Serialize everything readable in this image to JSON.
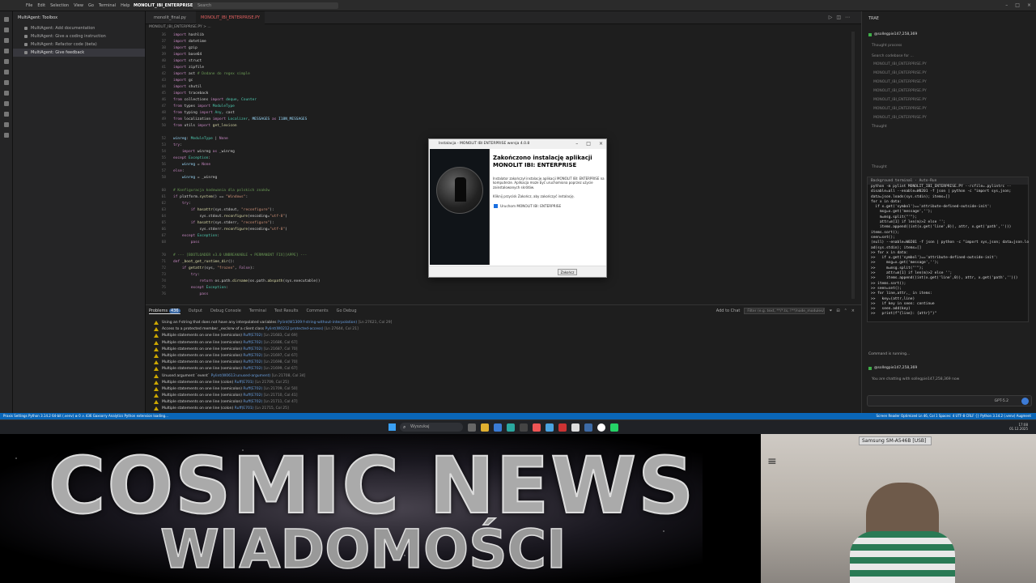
{
  "titlebar": {
    "menu": [
      "File",
      "Edit",
      "Selection",
      "View",
      "Go",
      "Terminal",
      "Help"
    ],
    "project": "MONOLIT_IBI_ENTERPRISE",
    "search": "Search"
  },
  "sidebar": {
    "header": "MultiAgent: Toolbox",
    "items": [
      "MultiAgent: Add documentation",
      "MultiAgent: Give a coding instruction",
      "MultiAgent: Refactor code (beta)",
      "MultiAgent: Give feedback"
    ]
  },
  "editor": {
    "tabs": [
      "monolit_final.py",
      "MONOLIT_IBI_ENTERPRISE.PY"
    ],
    "breadcrumb": "MONOLIT_IBI_ENTERPRISE.PY > ..."
  },
  "panel": {
    "tabs": [
      "Problems",
      "Output",
      "Debug Console",
      "Terminal",
      "Test Results",
      "Comments",
      "Go Debug"
    ],
    "problems_count": "436",
    "add_to_chat": "Add to Chat",
    "filter_placeholder": "Filter (e.g. text, **/*.ts, !**/node_modules/**)",
    "rows": [
      {
        "msg": "Using an f-string that does not have any interpolated variables",
        "src": "Pylint(W1309:f-string-without-interpolation)",
        "loc": "[Ln 27621, Col 29]"
      },
      {
        "msg": "Access to a protected member _exclsrw of a client class",
        "src": "Pylint(W0212:protected-access)",
        "loc": "[Ln 27644, Col 21]"
      },
      {
        "msg": "Multiple statements on one line (semicolon)",
        "src": "Ruff(E702)",
        "loc": "[Ln 21683, Col 69]"
      },
      {
        "msg": "Multiple statements on one line (semicolon)",
        "src": "Ruff(E702)",
        "loc": "[Ln 21686, Col 67]"
      },
      {
        "msg": "Multiple statements on one line (semicolon)",
        "src": "Ruff(E702)",
        "loc": "[Ln 21687, Col 70]"
      },
      {
        "msg": "Multiple statements on one line (semicolon)",
        "src": "Ruff(E702)",
        "loc": "[Ln 21697, Col 67]"
      },
      {
        "msg": "Multiple statements on one line (semicolon)",
        "src": "Ruff(E702)",
        "loc": "[Ln 21698, Col 70]"
      },
      {
        "msg": "Multiple statements on one line (semicolon)",
        "src": "Ruff(E702)",
        "loc": "[Ln 21699, Col 67]"
      },
      {
        "msg": "Unused argument `event`",
        "src": "Pylint(W0613:unused-argument)",
        "loc": "[Ln 21708, Col 34]"
      },
      {
        "msg": "Multiple statements on one line (colon)",
        "src": "Ruff(E701)",
        "loc": "[Ln 21709, Col 25]"
      },
      {
        "msg": "Multiple statements on one line (semicolon)",
        "src": "Ruff(E702)",
        "loc": "[Ln 21709, Col 50]"
      },
      {
        "msg": "Multiple statements on one line (semicolon)",
        "src": "Ruff(E702)",
        "loc": "[Ln 21710, Col 41]"
      },
      {
        "msg": "Multiple statements on one line (semicolon)",
        "src": "Ruff(E702)",
        "loc": "[Ln 21711, Col 47]"
      },
      {
        "msg": "Multiple statements on one line (colon)",
        "src": "Ruff(E701)",
        "loc": "[Ln 21715, Col 25]"
      }
    ]
  },
  "chat": {
    "title": "TRAE",
    "user": "@sollegpie147,258,369",
    "thought": "Thought process",
    "thought2": "Search codebase for ...",
    "files": [
      "MONOLIT_IBI_ENTERPRISE.PY",
      "MONOLIT_IBI_ENTERPRISE.PY",
      "MONOLIT_IBI_ENTERPRISE.PY",
      "MONOLIT_IBI_ENTERPRISE.PY",
      "MONOLIT_IBI_ENTERPRISE.PY",
      "MONOLIT_IBI_ENTERPRISE.PY",
      "MONOLIT_IBI_ENTERPRISE.PY"
    ],
    "thought3": "Thought",
    "thought4": "Thought",
    "terminal_header": "Background terminal · Auto-Run",
    "terminal_lines": [
      "python -m pylint MONOLIT_IBI_ENTERPRISE.PY --rcfile=.pylintrc --",
      "disable=all --enable=W0201 -f json | python -c \"import sys,json;",
      "data=json.loads(sys.stdin); items=[]",
      "for x in data:",
      "  if x.get('symbol')=='attribute-defined-outside-init':",
      "    msg=x.get('message','');",
      "    m=msg.split(\"'\");",
      "    attr=m[1] if len(m)>2 else '';",
      "    items.append((int(x.get('line',0)), attr, x.get('path','')))",
      "items.sort();",
      "seen=set();",
      "",
      "(null) --enable=W0201 -f json | python -c \"import sys,json; data=json.lo",
      "ad(sys.stdin); items=[]",
      ">> for x in data:",
      ">>   if x.get('symbol')=='attribute-defined-outside-init':",
      ">>     msg=x.get('message','');",
      ">>     m=msg.split(\"'\");",
      ">>     attr=m[1] if len(m)>2 else '';",
      ">>     items.append((int(x.get('line',0)), attr, x.get('path','')))",
      ">> items.sort();",
      ">> seen=set();",
      ">> for line,attr,_ in items:",
      ">>   key=(attr,line)",
      ">>   if key in seen: continue",
      ">>   seen.add(key)",
      ">>   print(f\"{line}: {attr}\")\""
    ],
    "running": "Command is running...",
    "user2": "@sollegpie147,258,369",
    "chatting": "You are chatting with sollegpie147,258,369 now",
    "model": "GPT-5.2"
  },
  "dialog": {
    "title": "Instalacja - MONOLIT IBI ENTERPRISE wersja 4.0.8",
    "heading": "Zakończono instalację aplikacji MONOLIT IBI: ENTERPRISE",
    "body": "Instalator zakończył instalację aplikacji MONOLIT IBI: ENTERPRISE na komputerze. Aplikacja może być uruchomiona poprzez użycie zainstalowanych skrótów.",
    "body2": "Kliknij przycisk Zakończ, aby zakończyć instalację.",
    "checkbox": "Uruchom MONOLIT IBI: ENTERPRISE",
    "finish": "Zakończ"
  },
  "statusbar": {
    "left": "Praxis Settings   Python 3.14.2 64-bit (.venv)   ⊗ 0 ⚠ 436   Gaxsorry Analytics   Python extension loading...",
    "right": "Screen Reader Optimized   Ln 46, Col 1   Spaces: 4   UTF-8   CRLF   {} Python   3.14.2 (.venv)   Augment"
  },
  "taskbar": {
    "search": "Wyszukaj",
    "time": "17:08",
    "date": "01.12.2025"
  },
  "banner": {
    "line1": "COSMIC NEWS",
    "line2": "WIADOMOŚCI"
  },
  "cam": {
    "label": "Samsung SM-A546B [USB]"
  }
}
